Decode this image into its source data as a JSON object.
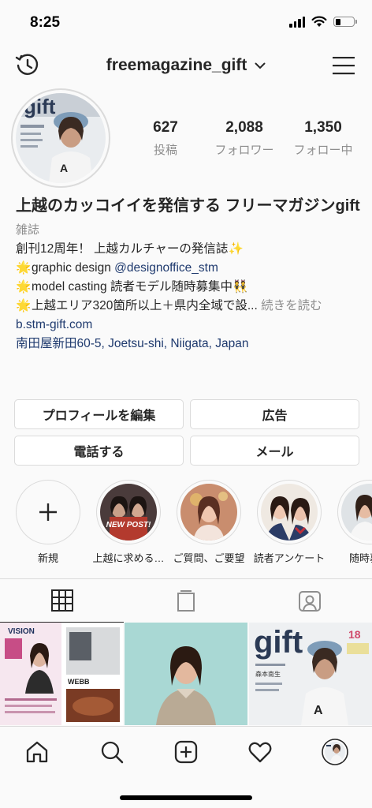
{
  "status": {
    "time": "8:25"
  },
  "header": {
    "username": "freemagazine_gift"
  },
  "stats": [
    {
      "value": "627",
      "label": "投稿"
    },
    {
      "value": "2,088",
      "label": "フォロワー"
    },
    {
      "value": "1,350",
      "label": "フォロー中"
    }
  ],
  "bio": {
    "name": "上越のカッコイイを発信する フリーマガジンgift",
    "category": "雑誌",
    "line1": "創刊12周年！ 上越カルチャーの発信誌",
    "line2_prefix": "graphic design ",
    "line2_mention": "@designoffice_stm",
    "line3": "model casting  読者モデル随時募集中",
    "line4": "上越エリア320箇所以上＋県内全域で設...",
    "more": "続きを読む",
    "website": "b.stm-gift.com",
    "address": "南田屋新田60-5, Joetsu-shi, Niigata, Japan",
    "emoji_sparkle": "✨",
    "emoji_star": "🌟",
    "emoji_dancers": "👯"
  },
  "buttons": {
    "edit_profile": "プロフィールを編集",
    "promote": "広告",
    "call": "電話する",
    "email": "メール"
  },
  "highlights": [
    {
      "label": "新規",
      "icon": "plus-icon"
    },
    {
      "label": "上越に求める…",
      "overlay": "NEW POST!"
    },
    {
      "label": "ご質問、ご要望"
    },
    {
      "label": "読者アンケート"
    },
    {
      "label": "随時募集"
    }
  ],
  "grid": {
    "post1_title": "VISION",
    "post1_badge": "WEBB",
    "post3_logo": "gift",
    "post3_no": "18",
    "post3_name": "森本南生"
  },
  "tabs": [
    "grid-icon",
    "igtv-icon",
    "tagged-icon"
  ],
  "bottom_nav": [
    "home-icon",
    "search-icon",
    "new-post-icon",
    "activity-icon",
    "profile-avatar"
  ],
  "colors": {
    "link": "#1f3a6e",
    "muted": "#8e8e8e",
    "border": "#dbdbdb",
    "text": "#262626"
  }
}
